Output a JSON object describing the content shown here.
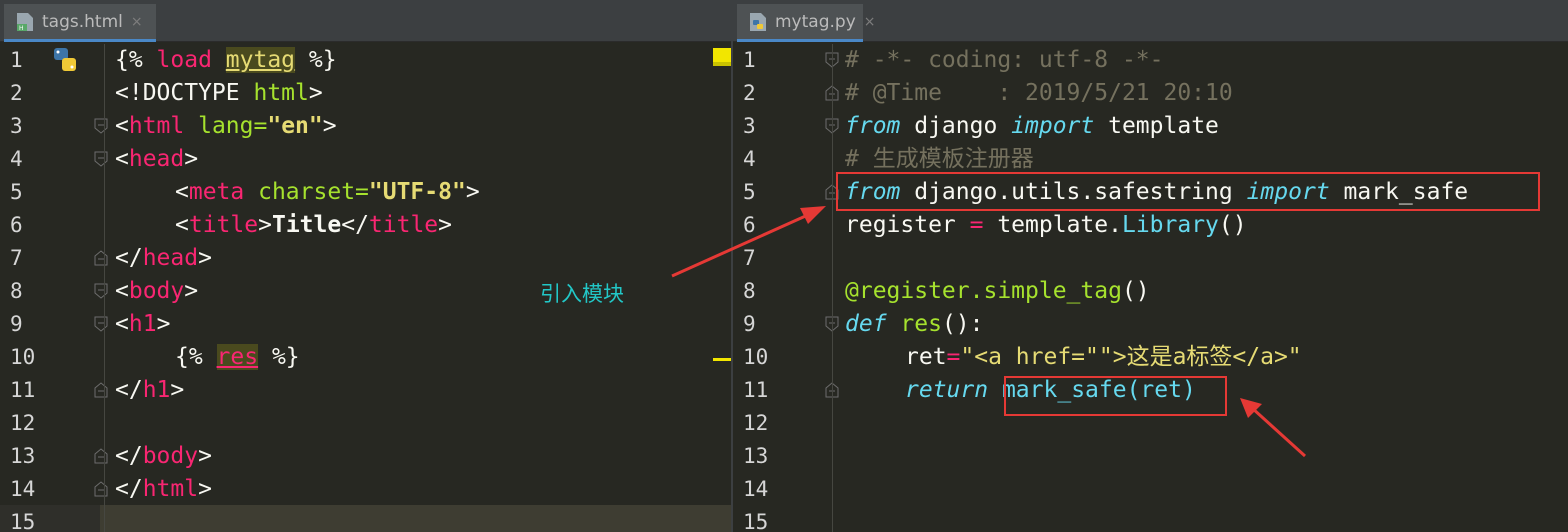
{
  "left_editor": {
    "tab": {
      "label": "tags.html",
      "close": "×",
      "icon": "html-file-icon"
    },
    "line_numbers": [
      "1",
      "2",
      "3",
      "4",
      "5",
      "6",
      "7",
      "8",
      "9",
      "10",
      "11",
      "12",
      "13",
      "14",
      "15"
    ],
    "gutter_icon": "python-icon"
  },
  "right_editor": {
    "tab": {
      "label": "mytag.py",
      "close": "×",
      "icon": "python-file-icon"
    },
    "line_numbers": [
      "1",
      "2",
      "3",
      "4",
      "5",
      "6",
      "7",
      "8",
      "9",
      "10",
      "11",
      "12",
      "13",
      "14",
      "15"
    ]
  },
  "annotation": {
    "text": "引入模块",
    "color": "#22c7c7",
    "box_color": "#e53935"
  },
  "theme": {
    "background": "#272822",
    "tab_underline": "#4a88c7"
  },
  "left_code": {
    "l1": [
      "{% ",
      "load",
      " ",
      "mytag",
      " %}"
    ],
    "l2": [
      "<!DOCTYPE ",
      "html",
      ">"
    ],
    "l3": [
      "<",
      "html",
      " ",
      "lang=",
      "\"en\"",
      ">"
    ],
    "l4": [
      "<",
      "head",
      ">"
    ],
    "l5": [
      "<",
      "meta",
      " ",
      "charset=",
      "\"UTF-8\"",
      ">"
    ],
    "l6": [
      "<",
      "title",
      ">",
      "Title",
      "</",
      "title",
      ">"
    ],
    "l7": [
      "</",
      "head",
      ">"
    ],
    "l8": [
      "<",
      "body",
      ">"
    ],
    "l9": [
      "<",
      "h1",
      ">"
    ],
    "l10": [
      "{% ",
      "res",
      " %}"
    ],
    "l11": [
      "</",
      "h1",
      ">"
    ],
    "l13": [
      "</",
      "body",
      ">"
    ],
    "l14": [
      "</",
      "html",
      ">"
    ]
  },
  "right_code": {
    "l1": "# -*- coding: utf-8 -*-",
    "l2": "# @Time    : 2019/5/21 20:10",
    "l3": [
      "from",
      " django ",
      "import",
      " template"
    ],
    "l4": "# 生成模板注册器",
    "l5": [
      "from",
      " django.utils.safestring ",
      "import",
      " mark_safe"
    ],
    "l6": [
      "register ",
      "=",
      " template.",
      "Library",
      "()"
    ],
    "l8": [
      "@register.simple_tag",
      "()"
    ],
    "l9": [
      "def",
      " ",
      "res",
      "():"
    ],
    "l10": [
      "ret",
      "=",
      "\"<a href=\"\">这是a标签</a>\""
    ],
    "l11": [
      "return",
      " ",
      "mark_safe(ret)"
    ]
  }
}
